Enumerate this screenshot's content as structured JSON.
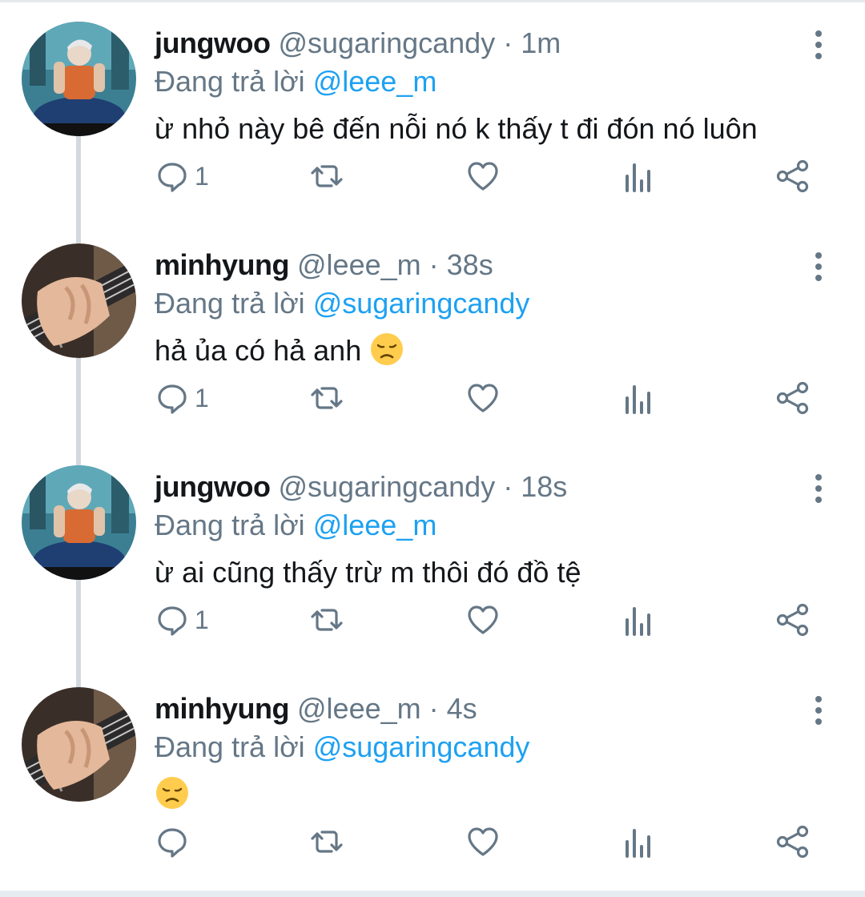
{
  "colors": {
    "name": "#14171a",
    "muted": "#657786",
    "link": "#1da1f2",
    "thread_line": "#d3d9de"
  },
  "tweets": [
    {
      "name": "jungwoo",
      "handle": "@sugaringcandy",
      "dot": "·",
      "time": "1m",
      "reply_prefix": "Đang trả lời",
      "reply_to": "@leee_m",
      "text": "ừ nhỏ này bê đến nỗi nó k thấy t đi đón nó luôn",
      "reply_count": "1",
      "avatar_icon": "avatar-photo",
      "emoji": ""
    },
    {
      "name": "minhyung",
      "handle": "@leee_m",
      "dot": "·",
      "time": "38s",
      "reply_prefix": "Đang trả lời",
      "reply_to": "@sugaringcandy",
      "text": "hả ủa có hả anh",
      "reply_count": "1",
      "avatar_icon": "guitar-photo",
      "emoji": "disappointed-face-emoji"
    },
    {
      "name": "jungwoo",
      "handle": "@sugaringcandy",
      "dot": "·",
      "time": "18s",
      "reply_prefix": "Đang trả lời",
      "reply_to": "@leee_m",
      "text": "ừ ai cũng thấy trừ m thôi đó đồ tệ",
      "reply_count": "1",
      "avatar_icon": "avatar-photo",
      "emoji": ""
    },
    {
      "name": "minhyung",
      "handle": "@leee_m",
      "dot": "·",
      "time": "4s",
      "reply_prefix": "Đang trả lời",
      "reply_to": "@sugaringcandy",
      "text": "",
      "reply_count": "",
      "avatar_icon": "guitar-photo",
      "emoji": "disappointed-face-emoji"
    }
  ]
}
